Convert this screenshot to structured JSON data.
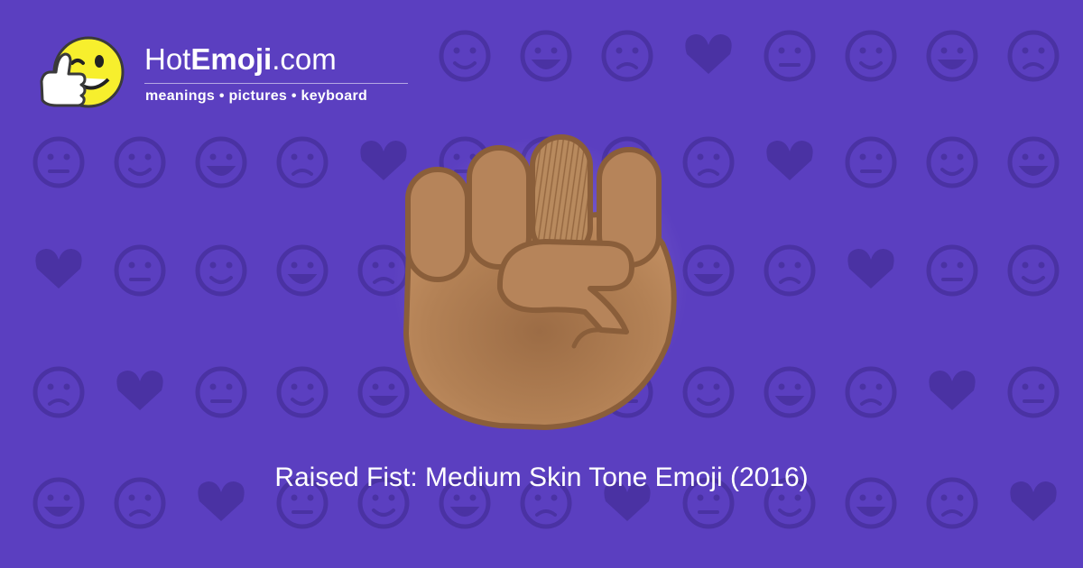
{
  "site": {
    "brand_light": "Hot",
    "brand_bold": "Emoji",
    "brand_suffix": ".com",
    "tagline": "meanings • pictures • keyboard",
    "mascot_icon": "winking-thumbs-up-smiley-icon"
  },
  "hero": {
    "emoji_icon": "raised-fist-medium-skin-tone-icon",
    "caption": "Raised Fist: Medium Skin Tone Emoji (2016)"
  },
  "colors": {
    "background": "#5b3fc0",
    "pattern": "#4a32a3",
    "text": "#ffffff",
    "skin": "#b07d52",
    "skin_outline": "#8a5e3a",
    "mascot_yellow": "#f7ef2d"
  }
}
